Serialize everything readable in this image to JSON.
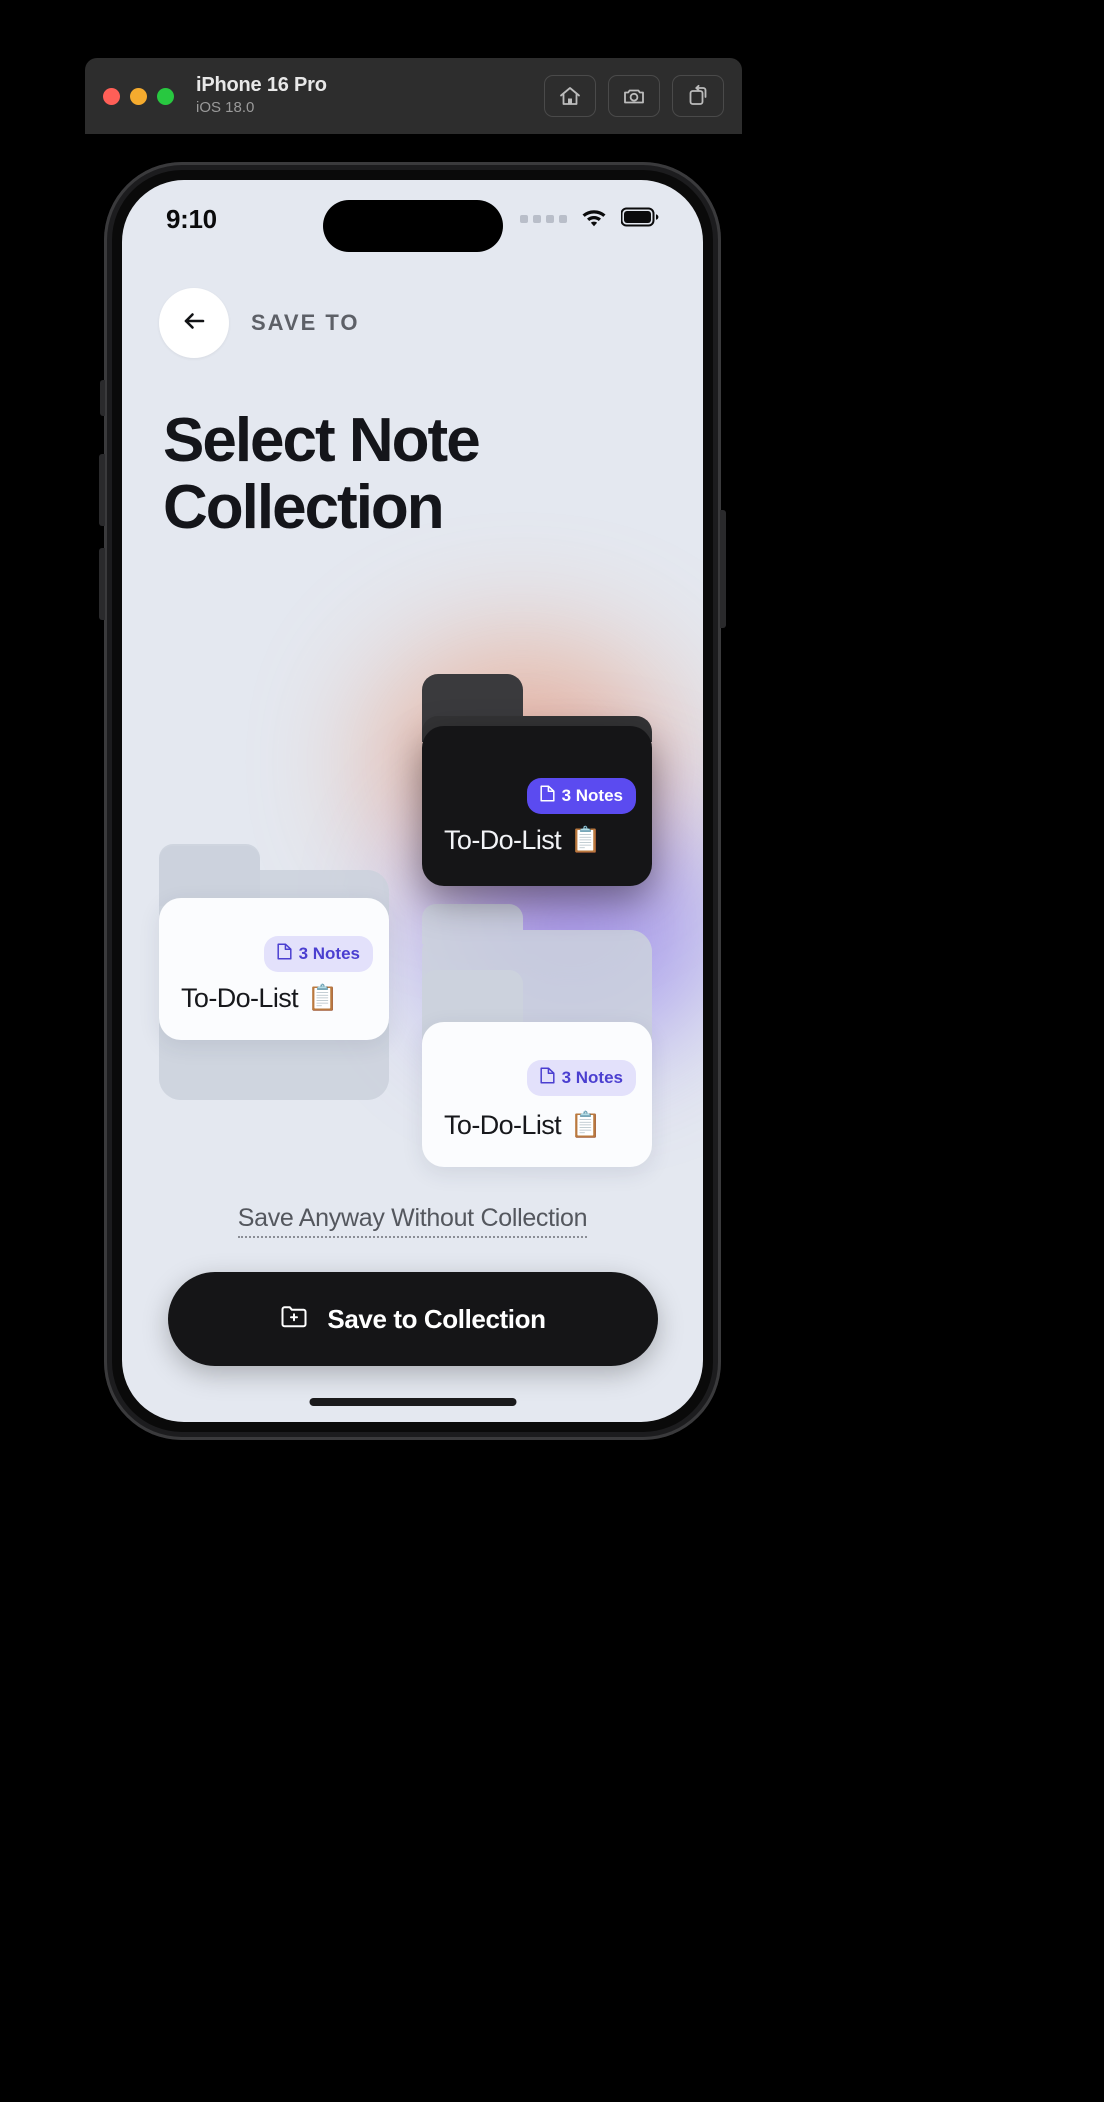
{
  "simulator": {
    "device_name": "iPhone 16 Pro",
    "os_version": "iOS 18.0",
    "traffic_lights": [
      {
        "name": "close",
        "color": "#ff5f57"
      },
      {
        "name": "minimize",
        "color": "#f5ab2e"
      },
      {
        "name": "maximize",
        "color": "#28c840"
      }
    ],
    "toolbar_buttons": [
      {
        "name": "home-button",
        "icon": "home-icon"
      },
      {
        "name": "screenshot-button",
        "icon": "camera-icon"
      },
      {
        "name": "rotate-button",
        "icon": "rotate-icon"
      }
    ]
  },
  "status_bar": {
    "time": "9:10",
    "signal_dots": 4,
    "wifi": "wifi-icon",
    "battery": "battery-full-icon"
  },
  "screen": {
    "eyebrow": "SAVE TO",
    "title": "Select Note Collection",
    "back_icon": "arrow-left-icon"
  },
  "collections": [
    {
      "name": "card-collection-left",
      "label": "To-Do-List",
      "emoji": "📋",
      "badge": "3 Notes",
      "badge_icon": "note-icon",
      "selected": false,
      "theme": "light"
    },
    {
      "name": "card-collection-selected",
      "label": "To-Do-List",
      "emoji": "📋",
      "badge": "3 Notes",
      "badge_icon": "note-icon",
      "selected": true,
      "theme": "dark"
    },
    {
      "name": "card-collection-right",
      "label": "To-Do-List",
      "emoji": "📋",
      "badge": "3 Notes",
      "badge_icon": "note-icon",
      "selected": false,
      "theme": "light"
    }
  ],
  "actions": {
    "skip_link": "Save Anyway Without Collection",
    "primary_button": "Save to Collection",
    "primary_button_icon": "folder-plus-icon"
  },
  "colors": {
    "accent": "#5b4bf0",
    "badge_light_bg": "#e3e1fb",
    "badge_light_text": "#4b3fd0",
    "screen_bg": "#e4e8f0",
    "dark_card": "#151517",
    "glow_orange": "#e8906a",
    "glow_purple": "#6b4fe8"
  }
}
